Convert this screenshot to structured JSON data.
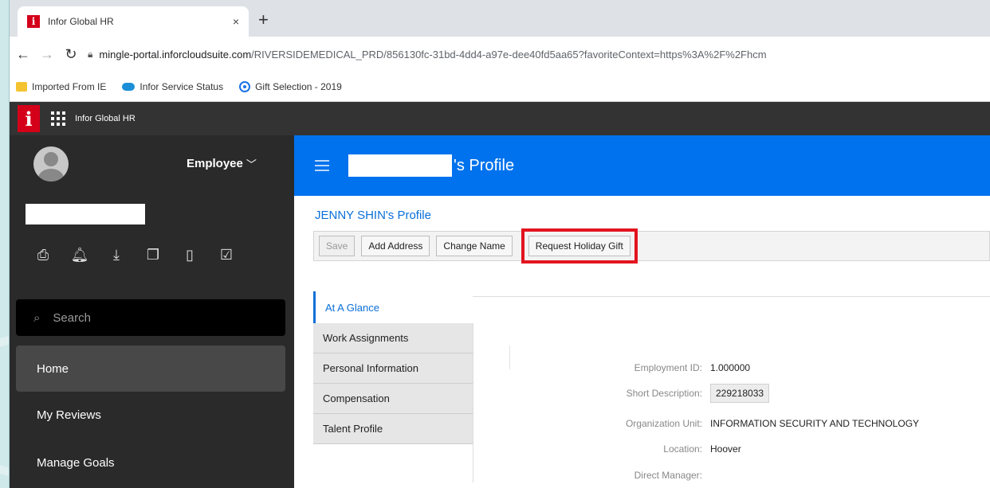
{
  "browser": {
    "tab_title": "Infor Global HR",
    "favicon_letter": "i",
    "tab_close": "×",
    "new_tab": "+",
    "url_host": "mingle-portal.inforcloudsuite.com",
    "url_path": "/RIVERSIDEMEDICAL_PRD/856130fc-31bd-4dd4-a97e-dee40fd5aa65?favoriteContext=https%3A%2F%2Fhcm",
    "bookmarks": [
      {
        "label": "Imported From IE",
        "icon": "folder-icon"
      },
      {
        "label": "Infor Service Status",
        "icon": "cloud-icon"
      },
      {
        "label": "Gift Selection - 2019",
        "icon": "radio-icon"
      }
    ]
  },
  "app": {
    "logo_letter": "i",
    "title": "Infor Global HR"
  },
  "sidebar": {
    "role": "Employee",
    "search_placeholder": "Search",
    "items": [
      {
        "label": "Home",
        "active": true
      },
      {
        "label": "My Reviews",
        "active": false
      },
      {
        "label": "Manage Goals",
        "active": false
      }
    ],
    "icons": [
      "print-icon",
      "notification-icon",
      "download-icon",
      "copy-icon",
      "document-icon",
      "checkbox-icon"
    ]
  },
  "content": {
    "header_suffix": "'s Profile",
    "profile_title": "JENNY SHIN's Profile",
    "toolbar": {
      "save": "Save",
      "add_address": "Add Address",
      "change_name": "Change Name",
      "request_gift": "Request Holiday Gift"
    },
    "tabs": [
      "At A Glance",
      "Work Assignments",
      "Personal Information",
      "Compensation",
      "Talent Profile"
    ],
    "fields": [
      {
        "label": "Employment ID:",
        "value": "1.000000"
      },
      {
        "label": "Short Description:",
        "value": "229218033"
      },
      {
        "label": "Organization Unit:",
        "value": "INFORMATION SECURITY AND TECHNOLOGY"
      },
      {
        "label": "Location:",
        "value": "Hoover"
      },
      {
        "label": "Direct Manager:",
        "value": ""
      }
    ]
  },
  "colors": {
    "header_blue": "#0072ed",
    "highlight_red": "#e2141f",
    "sidebar_dark": "#2a2a2a",
    "infor_red": "#d4001a"
  }
}
